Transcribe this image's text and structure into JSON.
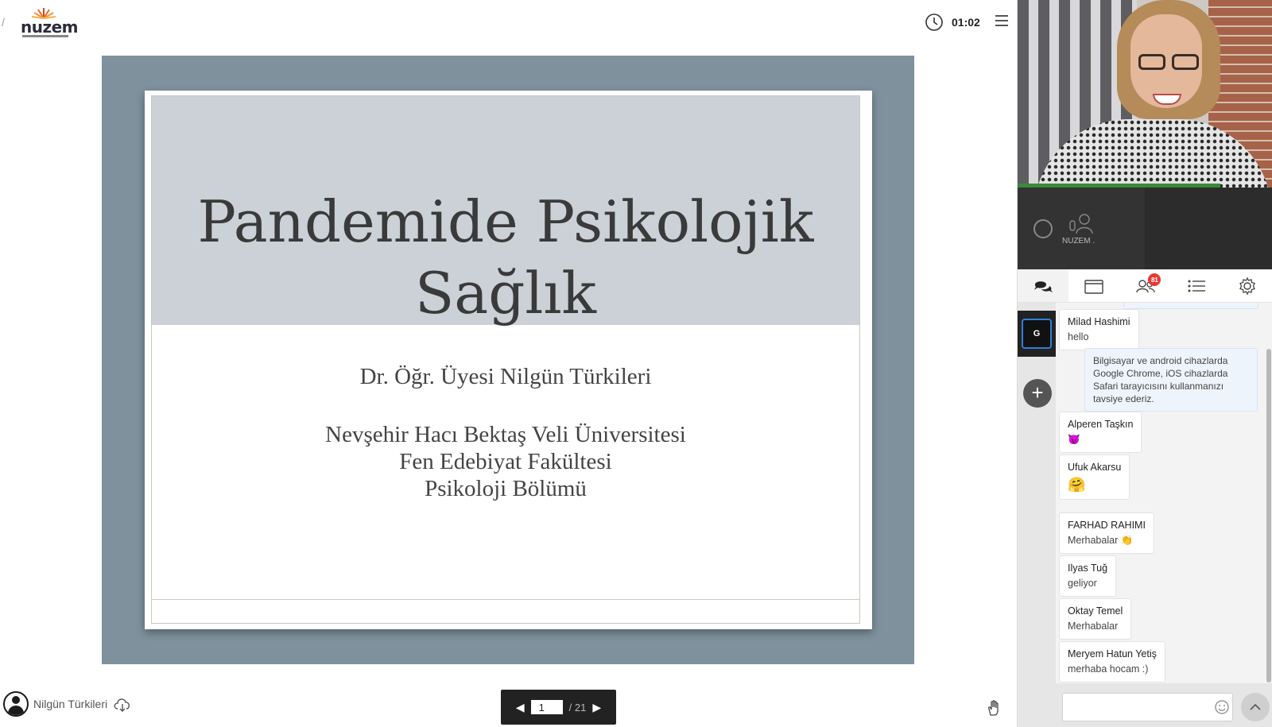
{
  "header": {
    "logo_text": "nuzem",
    "timer": "01:02"
  },
  "slide": {
    "title_line1": "Pandemide Psikolojik",
    "title_line2": "Sağlık",
    "author": "Dr. Öğr. Üyesi Nilgün Türkileri",
    "affiliation": [
      "Nevşehir Hacı Bektaş Veli Üniversitesi",
      "Fen Edebiyat Fakültesi",
      "Psikoloji Bölümü"
    ]
  },
  "footer": {
    "presenter": "Nilgün Türkileri",
    "page_current": "1",
    "page_total": "/ 21"
  },
  "side": {
    "small_video_label": "NUZEM .",
    "participants_badge": "81",
    "room_letter": "G",
    "add_room": "+"
  },
  "chat": {
    "messages": [
      {
        "name": "Milad Hashimi",
        "text": "hello"
      },
      {
        "system": "Bilgisayar ve android cihazlarda Google Chrome, iOS cihazlarda Safari tarayıcısını kullanmanızı tavsiye ederiz."
      },
      {
        "name": "Alperen Taşkın",
        "text": "😈"
      },
      {
        "name": "Ufuk Akarsu",
        "text": "🤗"
      },
      {
        "name": "FARHAD RAHIMI",
        "text": "Merhabalar 👏"
      },
      {
        "name": "Ilyas Tuğ",
        "text": "geliyor"
      },
      {
        "name": "Oktay Temel",
        "text": "Merhabalar"
      },
      {
        "name": "Meryem Hatun Yetiş",
        "text": "merhaba hocam :)"
      }
    ],
    "input_placeholder": ""
  },
  "colors": {
    "slide_frame": "#7e919d",
    "slide_band": "#cbd1d6",
    "badge": "#e53935",
    "room_border": "#2f7fd8"
  },
  "icons": [
    "clock-icon",
    "menu-icon",
    "chat-icon",
    "folder-icon",
    "participants-icon",
    "list-icon",
    "settings-icon",
    "emoji-icon",
    "chevron-up-icon",
    "raise-hand-icon",
    "cloud-icon",
    "user-icon"
  ]
}
